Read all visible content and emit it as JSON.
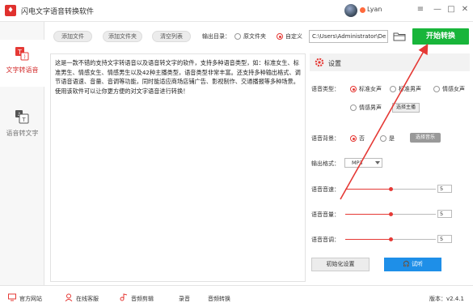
{
  "app": {
    "logo_text": "♦",
    "title": "闪电文字语音转换软件"
  },
  "user": {
    "name": "Lyan"
  },
  "window_controls": {
    "menu": "≡",
    "minimize": "—",
    "maximize": "□",
    "close": "✕"
  },
  "sidebar": {
    "items": [
      {
        "label": "文字转语音",
        "active": true
      },
      {
        "label": "语音转文字",
        "active": false
      }
    ]
  },
  "toolbar": {
    "add_file": "添加文件",
    "add_folder": "添加文件夹",
    "clear_list": "清空列表",
    "output_dir_label": "输出目录：",
    "option_original": "原文件夹",
    "option_custom": "自定义",
    "output_path": "C:\\Users\\Administrator\\De",
    "start_button": "开始转换"
  },
  "content": {
    "text": "这是一款不错的支持文字转语音以及语音转文字的软件，支持多种语音类型，如：标准女生、标准男生、情感女生、情感男生以及42种主播类型，语音类型非常丰富。还支持多种输出格式、调节语音语速、音量、音调等功能，同时能适应商场店铺广告、影视制作、交通播报等多种场景。使用该软件可以让你更方便的对文字语音进行转换！"
  },
  "settings": {
    "title": "设置",
    "voice_type_label": "语音类型：",
    "voice_options": [
      "标准女声",
      "标准男声",
      "情感女声",
      "情感男声"
    ],
    "voice_selected": "标准女声",
    "anchor_button": "选择主播",
    "background_label": "语音背景：",
    "bg_no": "否",
    "bg_yes": "是",
    "bg_selected": "否",
    "choose_music": "选择音乐",
    "format_label": "输出格式：",
    "format_value": "MP3",
    "speed_label": "语音音速：",
    "speed_value": "5",
    "volume_label": "语音音量：",
    "volume_value": "5",
    "pitch_label": "语音音调：",
    "pitch_value": "5",
    "slider_fraction": 0.5,
    "init_button": "初始化设置",
    "listen_button": "试听"
  },
  "footer": {
    "items": [
      "官方网站",
      "在线客服",
      "音频剪辑",
      "录音",
      "音频转换"
    ],
    "version": "版本：v2.4.1"
  },
  "colors": {
    "accent_red": "#e53935",
    "start_green": "#18b53a",
    "listen_blue": "#1e8fe8",
    "annotation_arrow": "#e53935"
  }
}
